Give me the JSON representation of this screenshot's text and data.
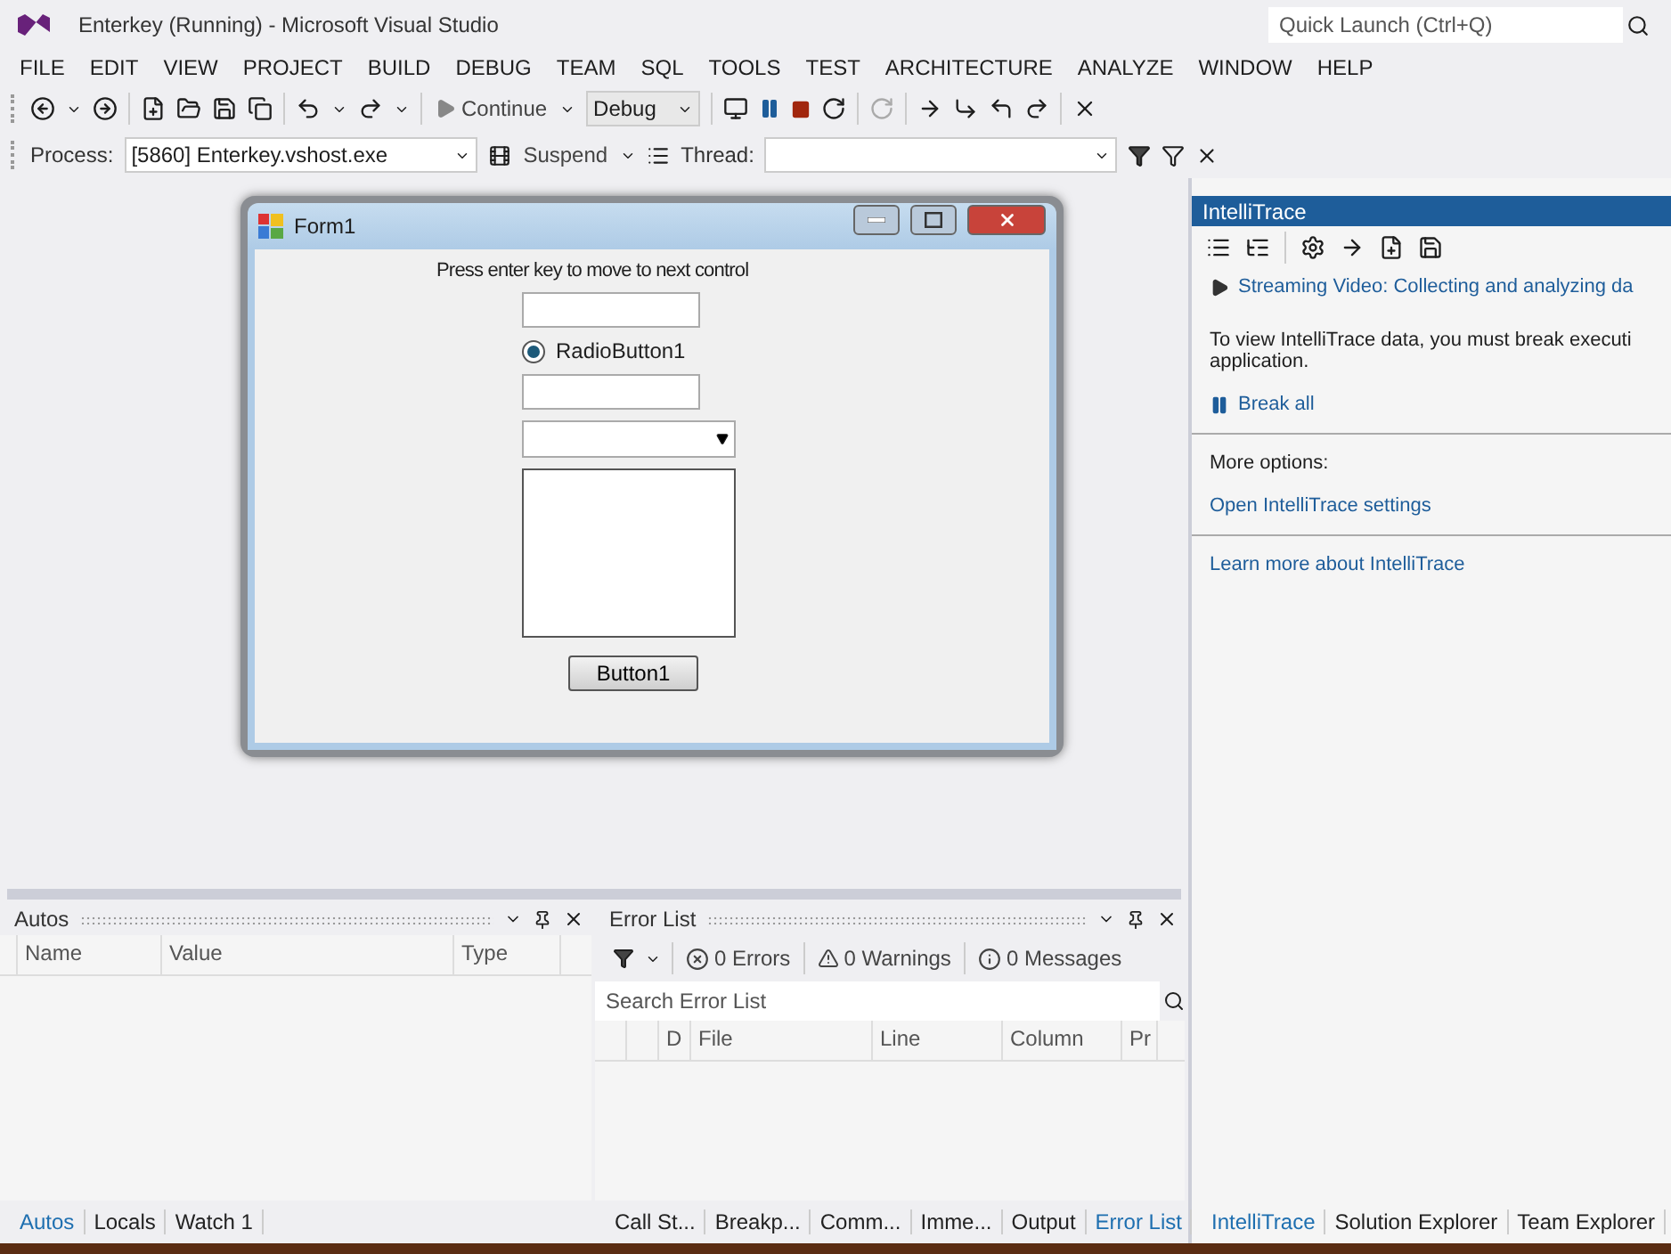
{
  "window": {
    "title": "Enterkey (Running) - Microsoft Visual Studio"
  },
  "quick_launch": {
    "placeholder": "Quick Launch (Ctrl+Q)"
  },
  "menu": [
    "FILE",
    "EDIT",
    "VIEW",
    "PROJECT",
    "BUILD",
    "DEBUG",
    "TEAM",
    "SQL",
    "TOOLS",
    "TEST",
    "ARCHITECTURE",
    "ANALYZE",
    "WINDOW",
    "HELP"
  ],
  "toolbar": {
    "continue": "Continue",
    "configuration": "Debug"
  },
  "debug_location": {
    "process_label": "Process:",
    "process": "[5860] Enterkey.vshost.exe",
    "suspend": "Suspend",
    "thread_label": "Thread:"
  },
  "form": {
    "title": "Form1",
    "label": "Press enter key to move to next control",
    "radio": {
      "label": "RadioButton1",
      "selected": true
    },
    "button": "Button1"
  },
  "intellitrace": {
    "title": "IntelliTrace",
    "video_link": "Streaming Video: Collecting and analyzing da",
    "message_lines": [
      "To view IntelliTrace data, you must break executi",
      "application."
    ],
    "break_all": "Break all",
    "more_options": "More options:",
    "settings_link": "Open IntelliTrace settings",
    "learn_link": "Learn more about IntelliTrace"
  },
  "autos": {
    "title": "Autos",
    "columns": [
      "Name",
      "Value",
      "Type"
    ]
  },
  "error_list": {
    "title": "Error List",
    "errors": "0 Errors",
    "warnings": "0 Warnings",
    "messages": "0 Messages",
    "search": {
      "placeholder": "Search Error List"
    },
    "columns": [
      "D",
      "File",
      "Line",
      "Column",
      "Pr"
    ]
  },
  "bottom_tabs_left": [
    {
      "label": "Autos",
      "selected": true
    },
    {
      "label": "Locals",
      "selected": false
    },
    {
      "label": "Watch 1",
      "selected": false
    }
  ],
  "bottom_tabs_middle": [
    {
      "label": "Call St...",
      "selected": false
    },
    {
      "label": "Breakp...",
      "selected": false
    },
    {
      "label": "Comm...",
      "selected": false
    },
    {
      "label": "Imme...",
      "selected": false
    },
    {
      "label": "Output",
      "selected": false
    },
    {
      "label": "Error List",
      "selected": true
    }
  ],
  "bottom_tabs_right": [
    {
      "label": "IntelliTrace",
      "selected": true
    },
    {
      "label": "Solution Explorer",
      "selected": false
    },
    {
      "label": "Team Explorer",
      "selected": false
    }
  ]
}
